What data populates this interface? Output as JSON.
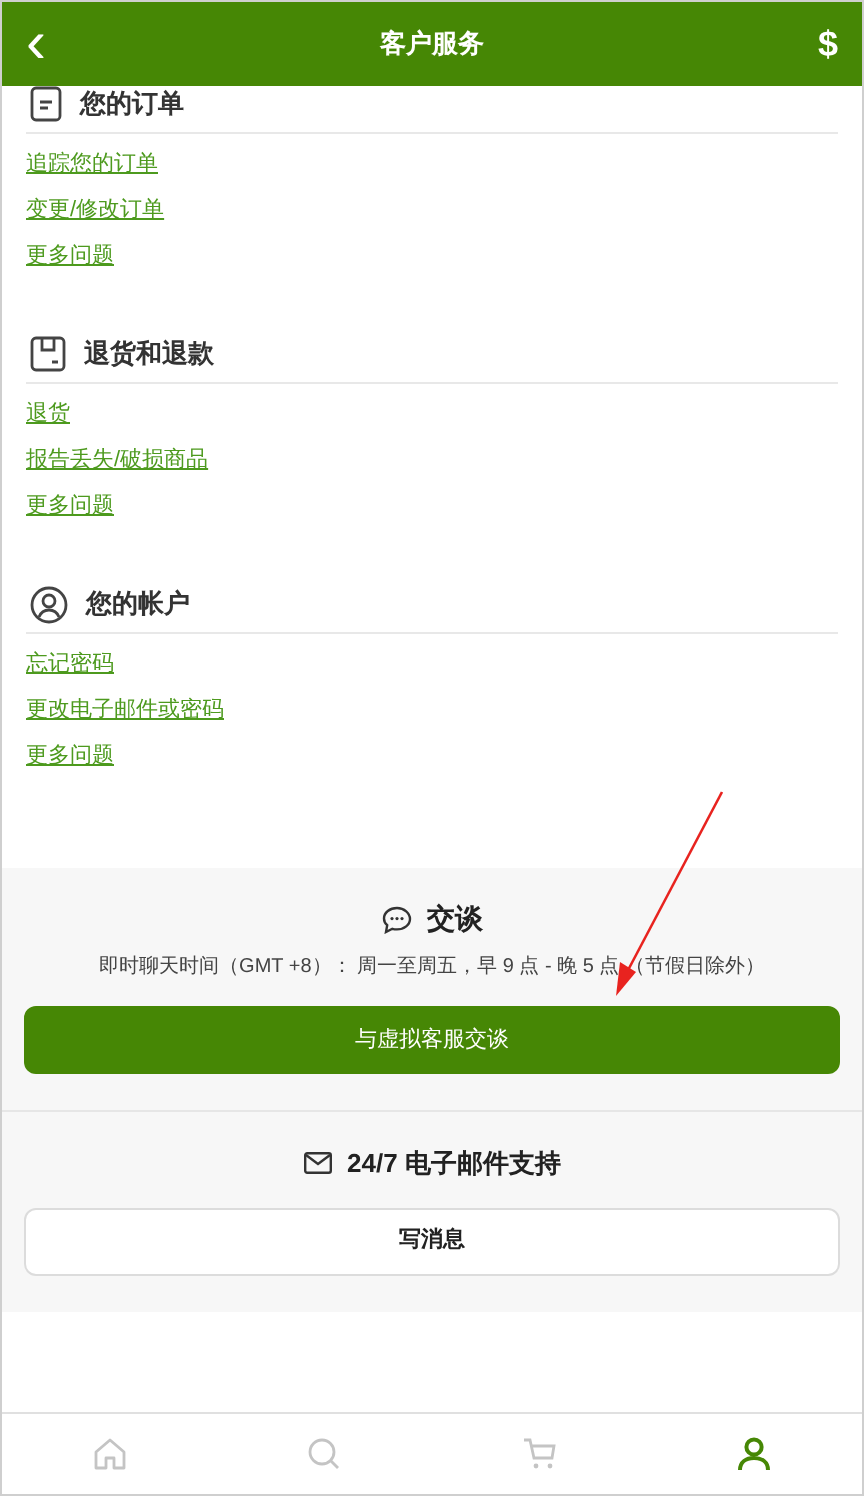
{
  "header": {
    "back": "‹",
    "title": "客户服务",
    "currency": "$"
  },
  "sections": [
    {
      "kind": "order",
      "title": "您的订单",
      "links": [
        "追踪您的订单",
        "变更/修改订单",
        "更多问题"
      ]
    },
    {
      "kind": "return",
      "title": "退货和退款",
      "links": [
        "退货",
        "报告丢失/破损商品",
        "更多问题"
      ]
    },
    {
      "kind": "account",
      "title": "您的帐户",
      "links": [
        "忘记密码",
        "更改电子邮件或密码",
        "更多问题"
      ]
    }
  ],
  "chat": {
    "title": "交谈",
    "hours": "即时聊天时间（GMT +8）： 周一至周五，早 9 点 - 晚 5 点 （节假日除外）",
    "button": "与虚拟客服交谈"
  },
  "email": {
    "title": "24/7 电子邮件支持",
    "button": "写消息"
  },
  "tabbar": [
    {
      "kind": "home",
      "selected": false
    },
    {
      "kind": "search",
      "selected": false
    },
    {
      "kind": "cart",
      "selected": false
    },
    {
      "kind": "account",
      "selected": true
    }
  ]
}
